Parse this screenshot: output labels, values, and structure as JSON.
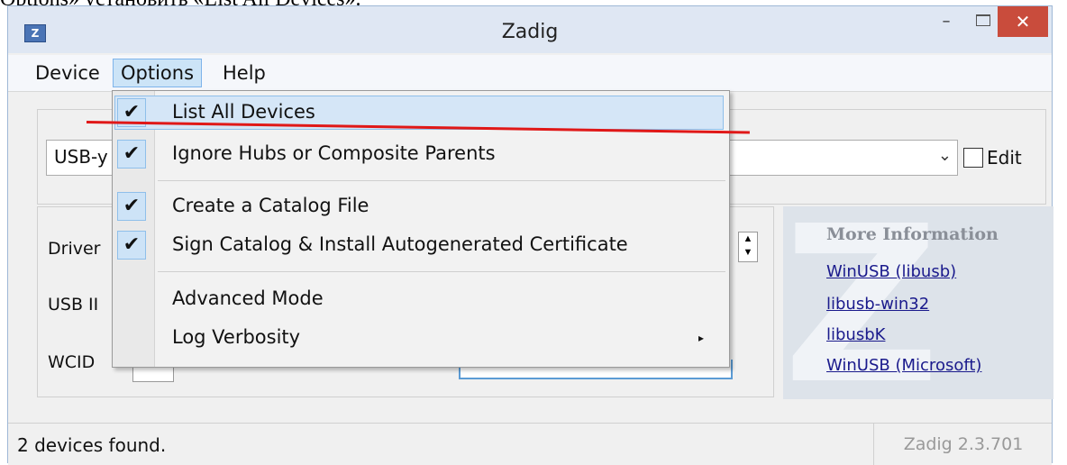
{
  "caption_text": "Options» установить «List All Devices».",
  "window": {
    "title": "Zadig",
    "icon_letter": "Z",
    "min_glyph": "–",
    "close_glyph": "✕"
  },
  "menubar": {
    "device": "Device",
    "options": "Options",
    "help": "Help"
  },
  "device_combo": {
    "value": "USB-y",
    "arrow": "⌄"
  },
  "edit_label": "Edit",
  "labels": {
    "driver": "Driver",
    "usb_id": "USB II",
    "wcid": "WCID"
  },
  "info": {
    "title": "More Information",
    "links": [
      "WinUSB (libusb)",
      "libusb-win32",
      "libusbK",
      "WinUSB (Microsoft)"
    ],
    "bg_letter": "Z"
  },
  "options_menu": {
    "items": [
      {
        "label": "List All Devices",
        "checked": "✔"
      },
      {
        "label": "Ignore Hubs or Composite Parents",
        "checked": "✔"
      },
      {
        "label": "Create a Catalog File",
        "checked": "✔"
      },
      {
        "label": "Sign Catalog & Install Autogenerated Certificate",
        "checked": "✔"
      },
      {
        "label": "Advanced Mode"
      },
      {
        "label": "Log Verbosity",
        "submenu_arrow": "▸"
      }
    ]
  },
  "status": {
    "text": "2 devices found.",
    "version": "Zadig 2.3.701"
  },
  "colors": {
    "close_button": "#c94c3c",
    "highlight": "#d5e6f7",
    "annotation_line": "#e01818",
    "link": "#1a1a8c"
  }
}
